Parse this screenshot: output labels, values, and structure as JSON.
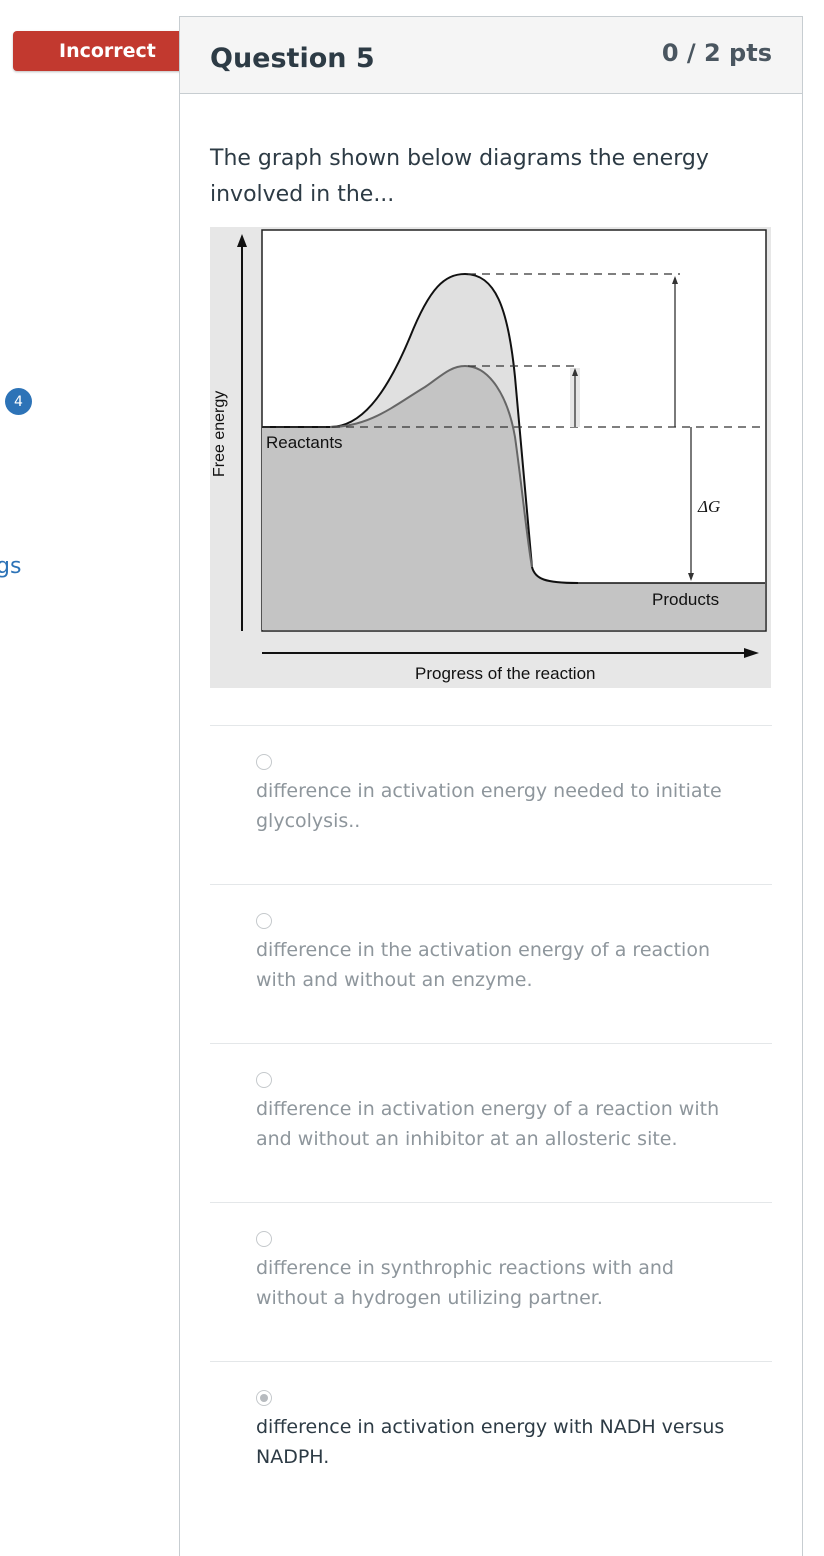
{
  "banner": {
    "label": "Incorrect"
  },
  "sidebar": {
    "badge_count": "4",
    "link_fragment": "gs"
  },
  "question": {
    "title": "Question 5",
    "points": "0 / 2 pts",
    "text": "The graph shown below diagrams the energy involved in the..."
  },
  "figure": {
    "y_axis_label": "Free energy",
    "x_axis_label": "Progress of the reaction",
    "reactants_label": "Reactants",
    "products_label": "Products",
    "delta_g_label": "ΔG"
  },
  "answers": [
    {
      "text": "difference in activation energy needed to initiate glycolysis..",
      "selected": false
    },
    {
      "text": "difference in the activation energy of a reaction with and without an enzyme.",
      "selected": false
    },
    {
      "text": "difference in activation energy of a reaction with and without an inhibitor at an allosteric site.",
      "selected": false
    },
    {
      "text": "difference in synthrophic reactions with and without a hydrogen utilizing partner.",
      "selected": false
    },
    {
      "text": "difference in activation energy with NADH versus NADPH.",
      "selected": true
    }
  ],
  "colors": {
    "incorrect": "#c2392f",
    "link": "#2d73b7"
  }
}
